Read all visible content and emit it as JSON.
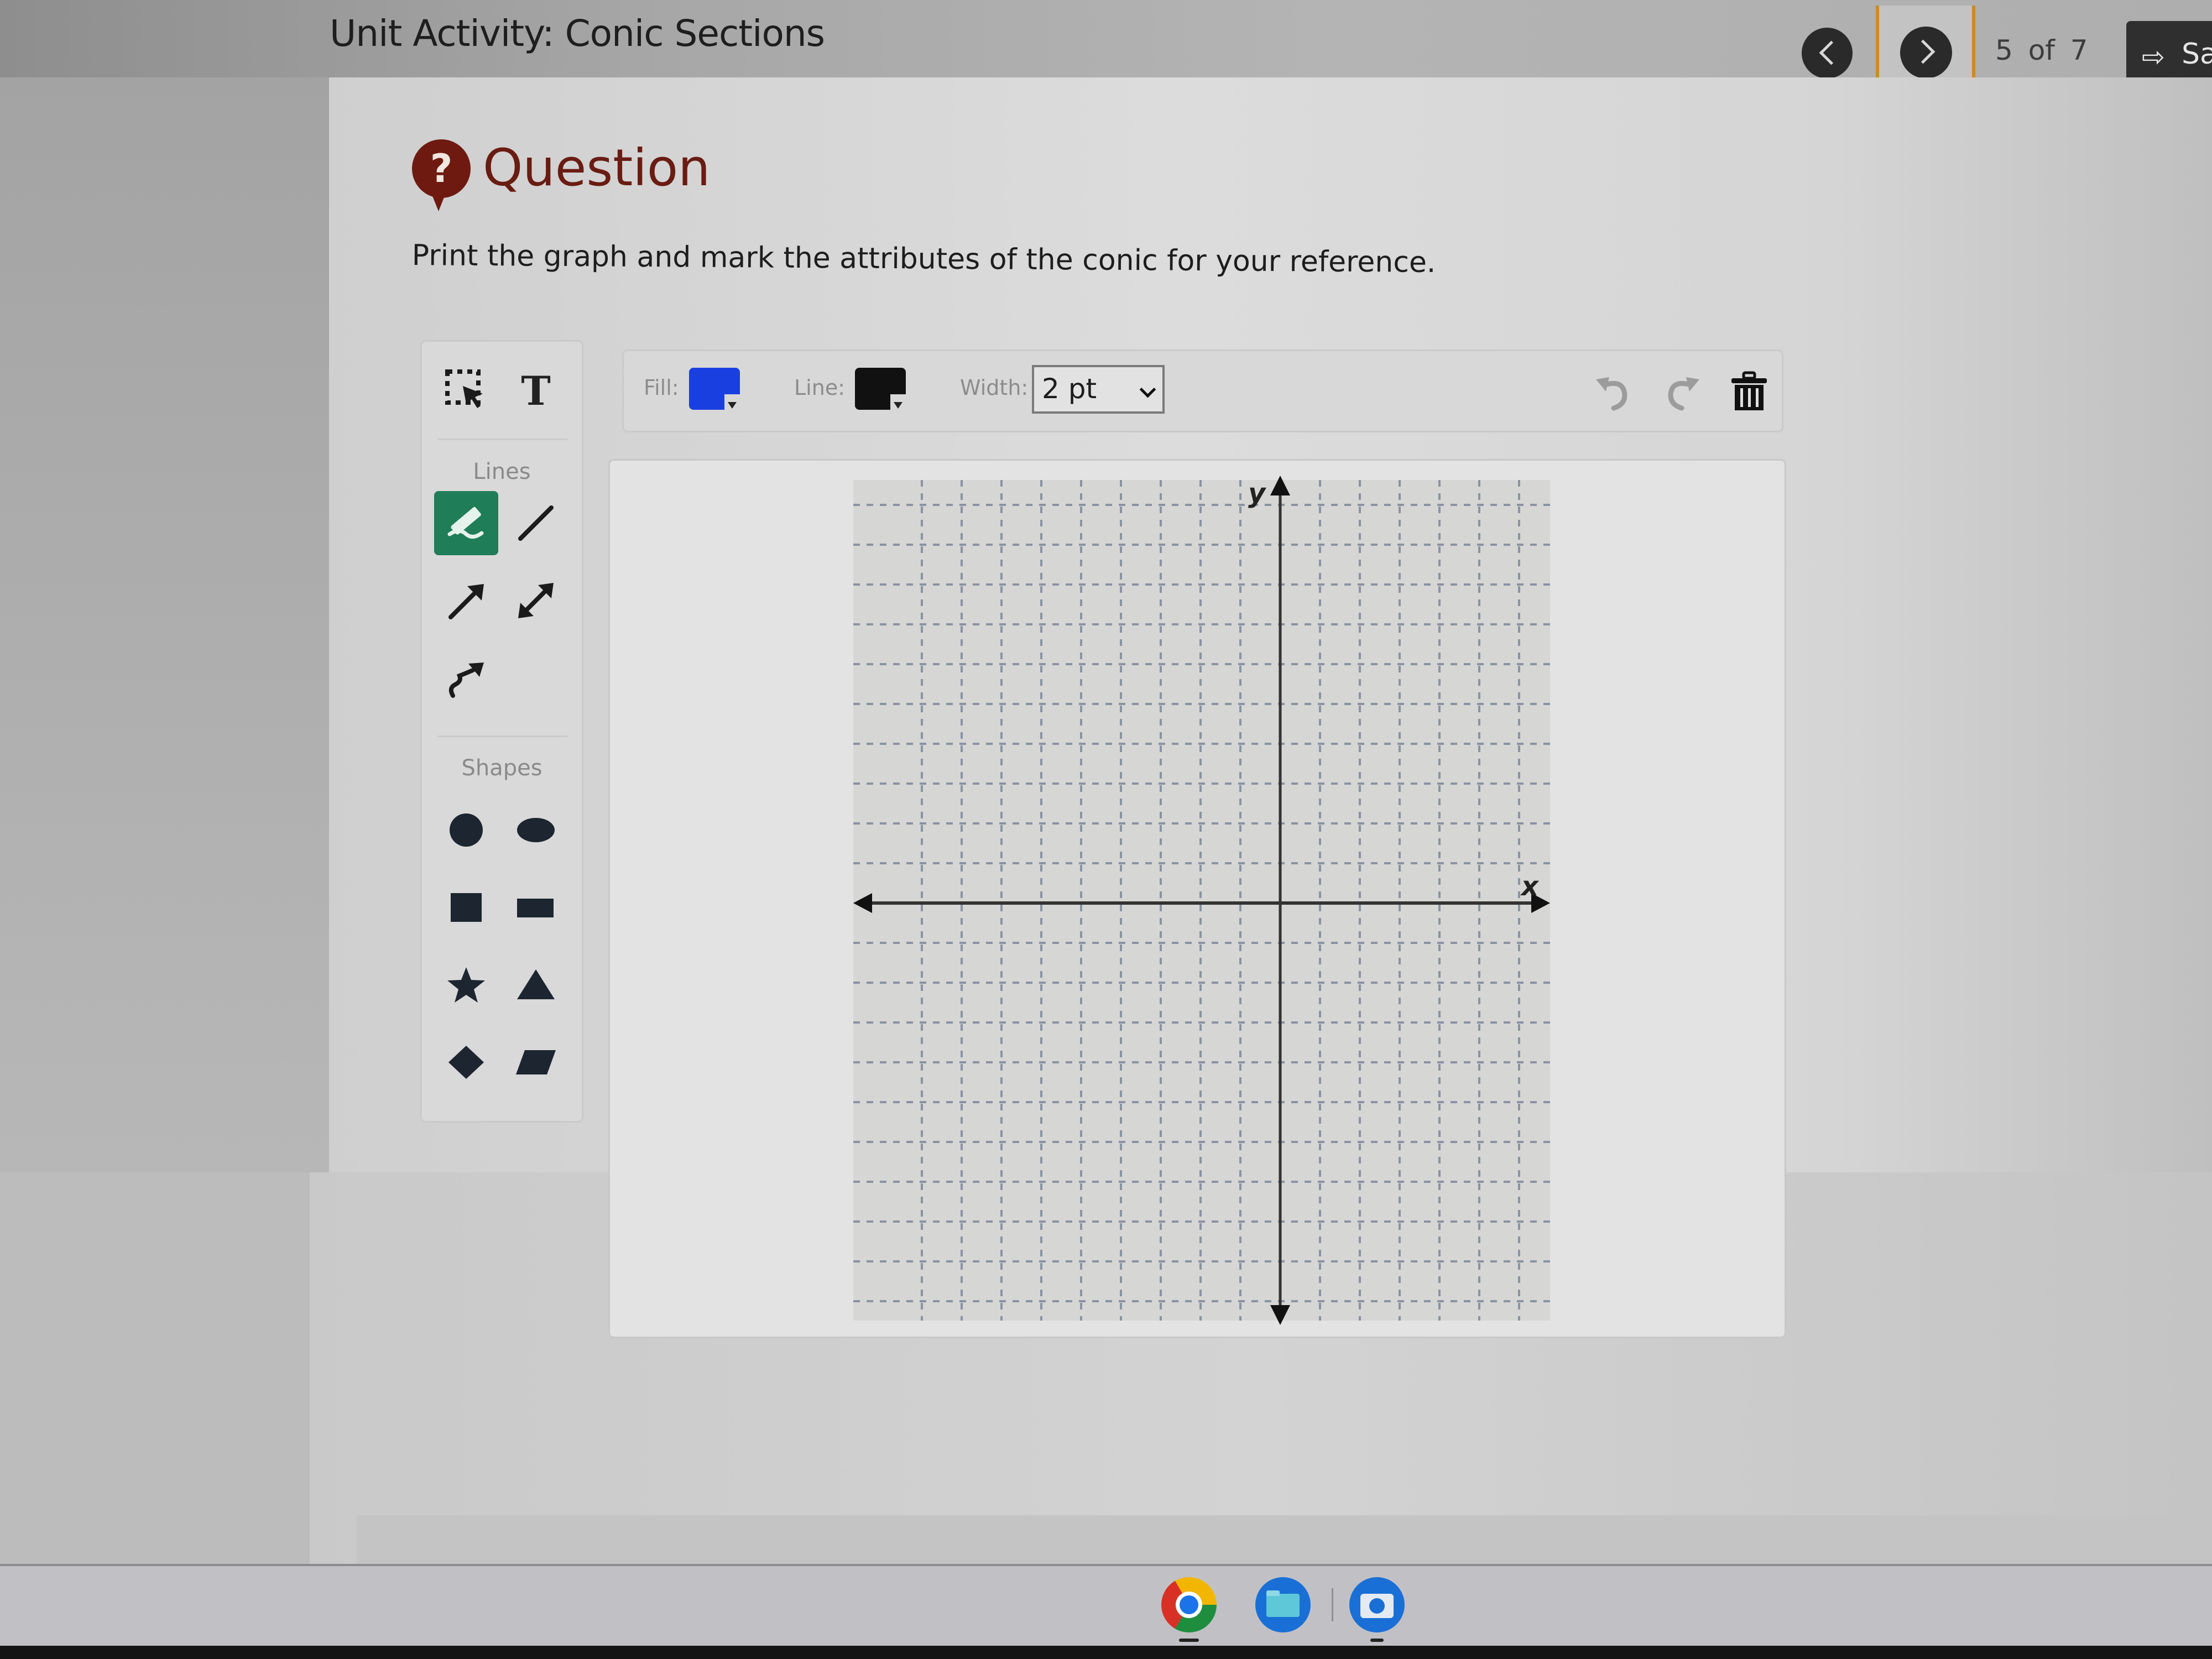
{
  "header": {
    "title": "Unit Activity: Conic Sections",
    "prev_label": "Previous",
    "next_label": "Next",
    "page_indicator": "5 of 7",
    "save_label": "Sa",
    "save_icon": "sign-out-icon"
  },
  "question": {
    "heading": "Question",
    "icon": "question-bubble-icon",
    "instruction": "Print the graph and mark the attributes of the conic for your reference."
  },
  "palette": {
    "top_tools": [
      {
        "name": "select",
        "icon": "select-marquee-icon"
      },
      {
        "name": "text",
        "icon": "text-icon",
        "glyph": "T"
      }
    ],
    "lines_label": "Lines",
    "line_tools": [
      {
        "name": "freehand",
        "icon": "pencil-icon",
        "active": true
      },
      {
        "name": "line-segment",
        "icon": "line-icon",
        "active": false
      },
      {
        "name": "ray",
        "icon": "arrow-icon",
        "active": false
      },
      {
        "name": "double-arrow",
        "icon": "double-arrow-icon",
        "active": false
      },
      {
        "name": "curved-arrow",
        "icon": "curved-arrow-icon",
        "active": false
      }
    ],
    "shapes_label": "Shapes",
    "shape_tools": [
      {
        "name": "circle",
        "icon": "circle-icon"
      },
      {
        "name": "ellipse",
        "icon": "ellipse-icon"
      },
      {
        "name": "square",
        "icon": "square-icon"
      },
      {
        "name": "rectangle",
        "icon": "rectangle-icon"
      },
      {
        "name": "star",
        "icon": "star-icon"
      },
      {
        "name": "triangle",
        "icon": "triangle-icon"
      },
      {
        "name": "diamond",
        "icon": "diamond-icon"
      },
      {
        "name": "parallelogram",
        "icon": "parallelogram-icon"
      }
    ]
  },
  "toolbar": {
    "fill_label": "Fill:",
    "fill_color": "#1a3fe0",
    "line_label": "Line:",
    "line_color": "#111111",
    "width_label": "Width:",
    "width_value": "2 pt",
    "undo_icon": "undo-icon",
    "redo_icon": "redo-icon",
    "delete_icon": "trash-icon"
  },
  "graph": {
    "x_axis_label": "x",
    "y_axis_label": "y",
    "grid_x_range": [
      -9,
      9
    ],
    "grid_y_range": [
      -10,
      10
    ],
    "grid_step": 1,
    "axis_color": "#333333",
    "grid_color": "#8a93a3",
    "plotted_items": []
  },
  "colors": {
    "accent_active_tool": "#1f7d57",
    "question_icon": "#6e1a10",
    "next_highlight": "#c98c25"
  },
  "taskbar": {
    "apps": [
      {
        "name": "chrome",
        "icon": "chrome-icon",
        "running": true
      },
      {
        "name": "files",
        "icon": "folder-icon",
        "running": false
      },
      {
        "name": "camera",
        "icon": "camera-icon",
        "running": true
      }
    ]
  }
}
